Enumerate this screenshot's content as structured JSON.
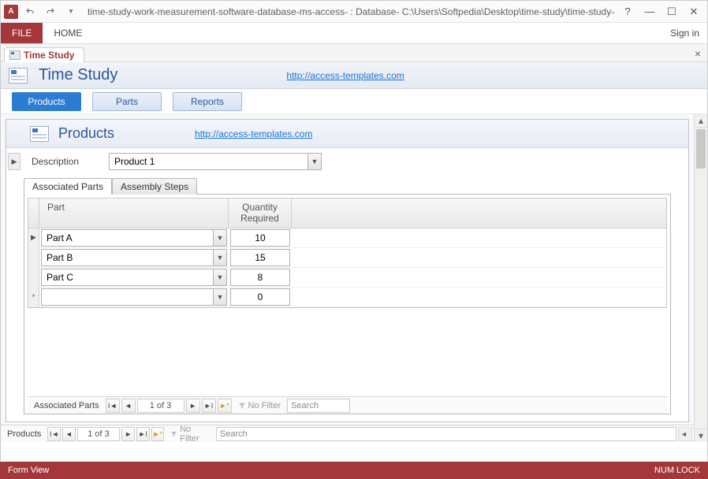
{
  "titlebar": {
    "path": "time-study-work-measurement-software-database-ms-access- : Database- C:\\Users\\Softpedia\\Desktop\\time-study\\time-study-work-measurem...",
    "app_letter": "A"
  },
  "ribbon": {
    "file": "FILE",
    "home": "HOME",
    "signin": "Sign in"
  },
  "doc_tab": {
    "title": "Time Study"
  },
  "headerband": {
    "title": "Time Study",
    "link": "http://access-templates.com"
  },
  "nav": {
    "products": "Products",
    "parts": "Parts",
    "reports": "Reports"
  },
  "subform": {
    "title": "Products",
    "link": "http://access-templates.com",
    "desc_label": "Description",
    "desc_value": "Product 1"
  },
  "subtabs": {
    "assoc": "Associated Parts",
    "steps": "Assembly Steps"
  },
  "grid": {
    "col_part": "Part",
    "col_qty_line1": "Quantity",
    "col_qty_line2": "Required",
    "rows": [
      {
        "part": "Part A",
        "qty": "10",
        "sel": "▶"
      },
      {
        "part": "Part B",
        "qty": "15",
        "sel": ""
      },
      {
        "part": "Part C",
        "qty": "8",
        "sel": ""
      },
      {
        "part": "",
        "qty": "0",
        "sel": "*"
      }
    ]
  },
  "recnav_inner": {
    "label": "Associated Parts",
    "pos": "1 of 3",
    "nofilter": "No Filter",
    "search": "Search"
  },
  "recnav_outer": {
    "label": "Products",
    "pos": "1 of 3",
    "nofilter": "No Filter",
    "search": "Search"
  },
  "statusbar": {
    "left": "Form View",
    "right": "NUM LOCK"
  }
}
